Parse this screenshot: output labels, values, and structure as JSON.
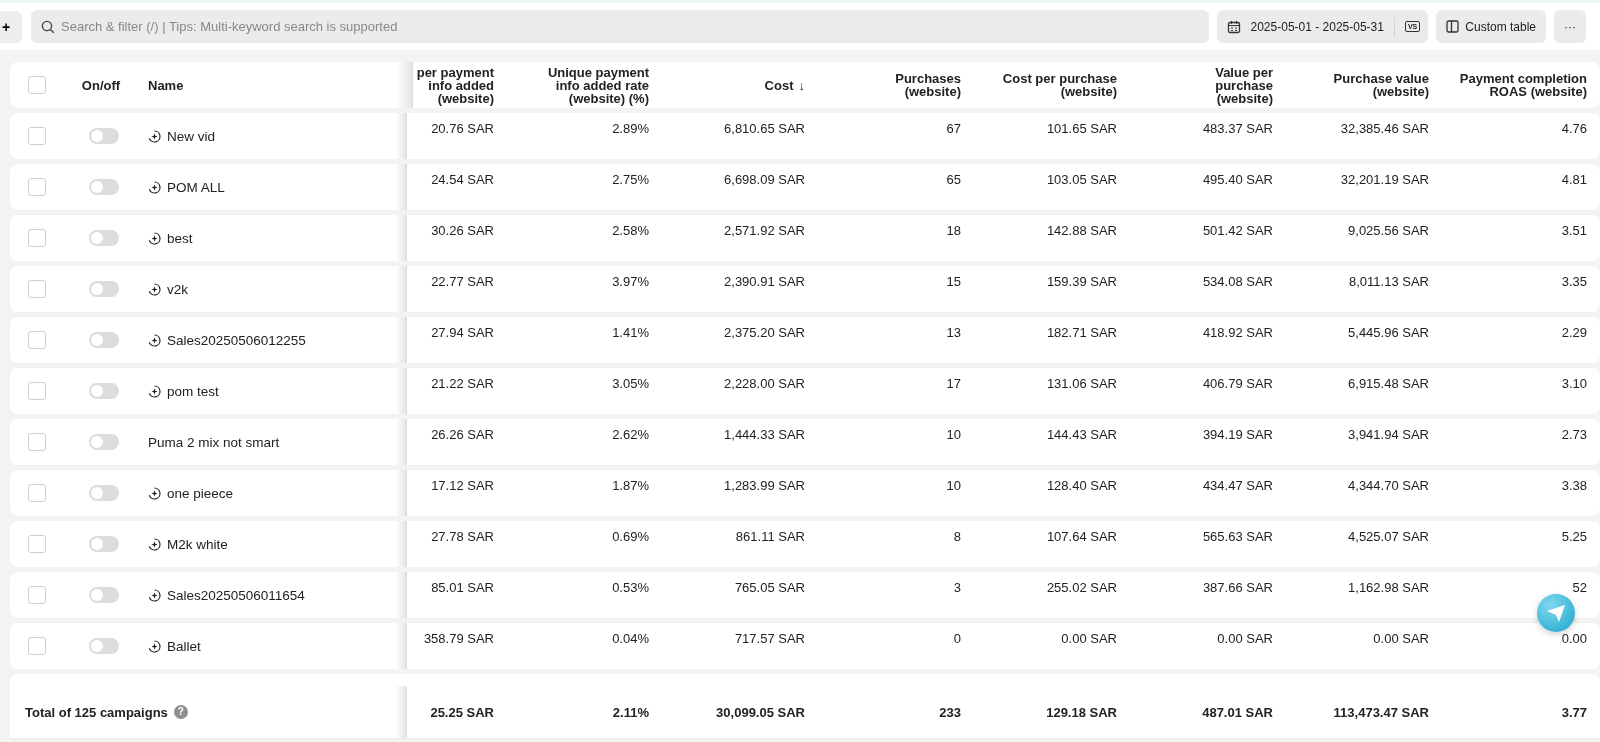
{
  "toolbar": {
    "add_label": "+",
    "search": {
      "placeholder": "Search & filter (/) | Tips: Multi-keyword search is supported"
    },
    "date_range": "2025-05-01 - 2025-05-31",
    "compare_label": "VS",
    "custom_table": "Custom table",
    "more": "···"
  },
  "table": {
    "columns": [
      {
        "kind": "check",
        "checked": false
      },
      {
        "kind": "toggle",
        "label": "On/off"
      },
      {
        "kind": "name",
        "label": "Name"
      },
      {
        "kind": "num",
        "label": "per payment info added (website)"
      },
      {
        "kind": "num",
        "label": "Unique payment info added rate (website) (%)"
      },
      {
        "kind": "num",
        "label": "Cost",
        "sort": "↓"
      },
      {
        "kind": "num",
        "label": "Purchases (website)"
      },
      {
        "kind": "num",
        "label": "Cost per purchase (website)"
      },
      {
        "kind": "num",
        "label": "Value per purchase (website)"
      },
      {
        "kind": "num",
        "label": "Purchase value (website)"
      },
      {
        "kind": "num",
        "label": "Payment completion ROAS (website)"
      }
    ],
    "rows": [
      {
        "checked": false,
        "on": false,
        "smart": true,
        "name": "New vid",
        "values": [
          "20.76 SAR",
          "2.89%",
          "6,810.65 SAR",
          "67",
          "101.65 SAR",
          "483.37 SAR",
          "32,385.46 SAR",
          "4.76"
        ]
      },
      {
        "checked": false,
        "on": false,
        "smart": true,
        "name": "POM ALL",
        "values": [
          "24.54 SAR",
          "2.75%",
          "6,698.09 SAR",
          "65",
          "103.05 SAR",
          "495.40 SAR",
          "32,201.19 SAR",
          "4.81"
        ]
      },
      {
        "checked": false,
        "on": false,
        "smart": true,
        "name": "best",
        "values": [
          "30.26 SAR",
          "2.58%",
          "2,571.92 SAR",
          "18",
          "142.88 SAR",
          "501.42 SAR",
          "9,025.56 SAR",
          "3.51"
        ]
      },
      {
        "checked": false,
        "on": false,
        "smart": true,
        "name": "v2k",
        "values": [
          "22.77 SAR",
          "3.97%",
          "2,390.91 SAR",
          "15",
          "159.39 SAR",
          "534.08 SAR",
          "8,011.13 SAR",
          "3.35"
        ]
      },
      {
        "checked": false,
        "on": false,
        "smart": true,
        "name": "Sales20250506012255",
        "values": [
          "27.94 SAR",
          "1.41%",
          "2,375.20 SAR",
          "13",
          "182.71 SAR",
          "418.92 SAR",
          "5,445.96 SAR",
          "2.29"
        ]
      },
      {
        "checked": false,
        "on": false,
        "smart": true,
        "name": "pom test",
        "values": [
          "21.22 SAR",
          "3.05%",
          "2,228.00 SAR",
          "17",
          "131.06 SAR",
          "406.79 SAR",
          "6,915.48 SAR",
          "3.10"
        ]
      },
      {
        "checked": false,
        "on": false,
        "smart": false,
        "name": "Puma 2 mix not smart",
        "values": [
          "26.26 SAR",
          "2.62%",
          "1,444.33 SAR",
          "10",
          "144.43 SAR",
          "394.19 SAR",
          "3,941.94 SAR",
          "2.73"
        ]
      },
      {
        "checked": false,
        "on": false,
        "smart": true,
        "name": "one pieece",
        "values": [
          "17.12 SAR",
          "1.87%",
          "1,283.99 SAR",
          "10",
          "128.40 SAR",
          "434.47 SAR",
          "4,344.70 SAR",
          "3.38"
        ]
      },
      {
        "checked": false,
        "on": false,
        "smart": true,
        "name": "M2k white",
        "values": [
          "27.78 SAR",
          "0.69%",
          "861.11 SAR",
          "8",
          "107.64 SAR",
          "565.63 SAR",
          "4,525.07 SAR",
          "5.25"
        ]
      },
      {
        "checked": false,
        "on": false,
        "smart": true,
        "name": "Sales20250506011654",
        "values": [
          "85.01 SAR",
          "0.53%",
          "765.05 SAR",
          "3",
          "255.02 SAR",
          "387.66 SAR",
          "1,162.98 SAR",
          "52"
        ]
      },
      {
        "checked": false,
        "on": false,
        "smart": true,
        "name": "Ballet",
        "values": [
          "358.79 SAR",
          "0.04%",
          "717.57 SAR",
          "0",
          "0.00 SAR",
          "0.00 SAR",
          "0.00 SAR",
          "0.00"
        ]
      }
    ],
    "total": {
      "label": "Total of 125 campaigns",
      "help": "?",
      "values": [
        "25.25 SAR",
        "2.11%",
        "30,099.05 SAR",
        "233",
        "129.18 SAR",
        "487.01 SAR",
        "113,473.47 SAR",
        "3.77"
      ]
    }
  }
}
